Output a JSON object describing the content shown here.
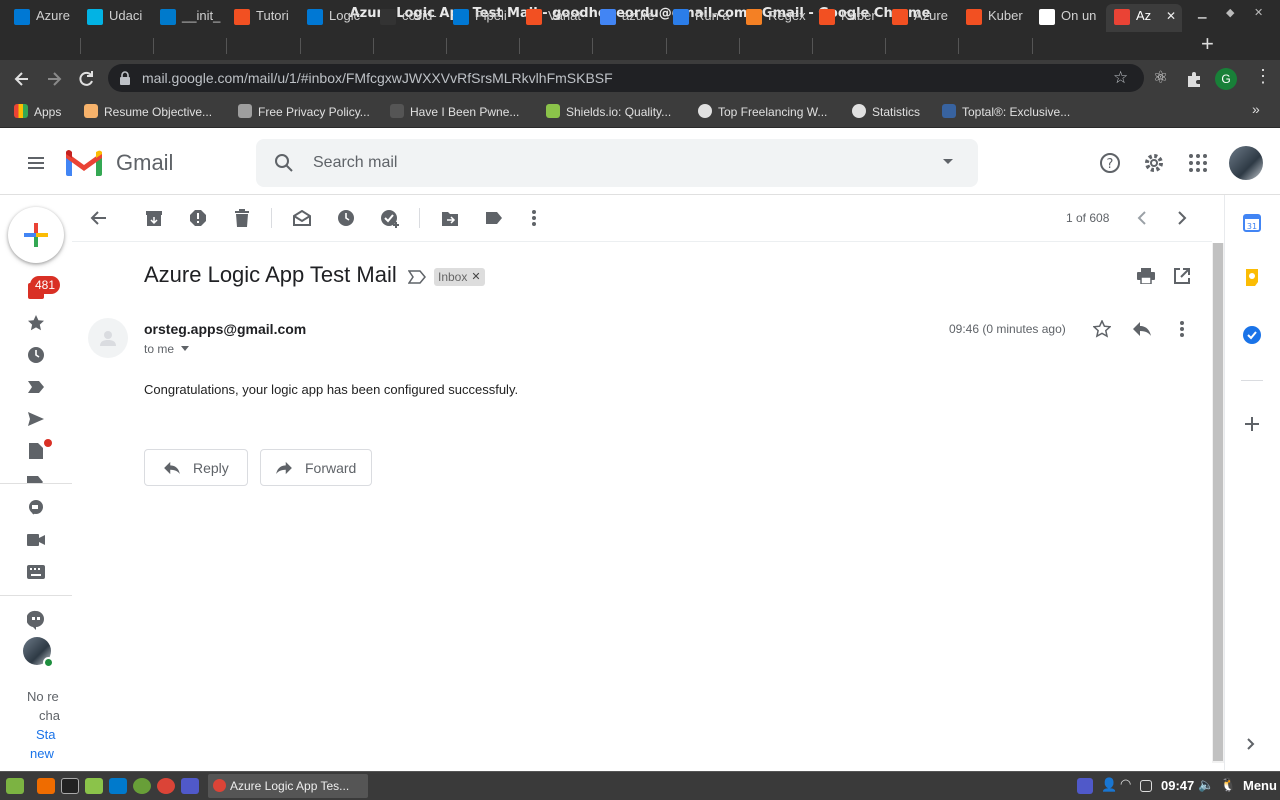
{
  "window": {
    "title": "Azure Logic App Test Mail - goodhopeordu@gmail.com - Gmail - Google Chrome"
  },
  "tabs": [
    {
      "label": "Azure",
      "color": "#0078d4"
    },
    {
      "label": "Udaci",
      "color": "#02b3e4"
    },
    {
      "label": "__init_",
      "color": "#007acc"
    },
    {
      "label": "Tutori",
      "color": "#f25022"
    },
    {
      "label": "Logic",
      "color": "#0078d4"
    },
    {
      "label": "covid-",
      "color": "#333333"
    },
    {
      "label": "Pipeli",
      "color": "#0078d4"
    },
    {
      "label": "Variat",
      "color": "#f25022"
    },
    {
      "label": "azure",
      "color": "#4285f4"
    },
    {
      "label": "Run a",
      "color": "#2b7de9"
    },
    {
      "label": "Regex",
      "color": "#f48024"
    },
    {
      "label": "Kuber",
      "color": "#f25022"
    },
    {
      "label": "Azure",
      "color": "#f25022"
    },
    {
      "label": "Kuber",
      "color": "#f25022"
    },
    {
      "label": "On un",
      "color": "#ffffff"
    },
    {
      "label": "Az",
      "color": "#ea4335"
    }
  ],
  "browser": {
    "url": "mail.google.com/mail/u/1/#inbox/FMfcgxwJWXXVvRfSrsMLRkvlhFmSKBSF",
    "profile_initial": "G"
  },
  "bookmarks": [
    {
      "label": "Apps",
      "color": "#4285f4"
    },
    {
      "label": "Resume Objective...",
      "color": "#f6b26b"
    },
    {
      "label": "Free Privacy Policy...",
      "color": "#9e9e9e"
    },
    {
      "label": "Have I Been Pwne...",
      "color": "#555555"
    },
    {
      "label": "Shields.io: Quality...",
      "color": "#8bc34a"
    },
    {
      "label": "Top Freelancing W...",
      "color": "#e0e0e0"
    },
    {
      "label": "Statistics",
      "color": "#e0e0e0"
    },
    {
      "label": "Toptal®: Exclusive...",
      "color": "#3863a0"
    }
  ],
  "gmail": {
    "logo_text": "Gmail",
    "search_placeholder": "Search mail",
    "inbox_badge": "481",
    "pagination": "1 of 608",
    "chat_text_1": "No re",
    "chat_text_2": "cha",
    "chat_link_1": "Sta",
    "chat_link_2": "new"
  },
  "email": {
    "subject": "Azure Logic App Test Mail",
    "label": "Inbox",
    "sender": "orsteg.apps@gmail.com",
    "recipient": "to me",
    "time": "09:46 (0 minutes ago)",
    "body": "Congratulations, your logic app has been configured successfuly.",
    "reply_label": "Reply",
    "forward_label": "Forward"
  },
  "taskbar": {
    "window_label": "Azure Logic App Tes...",
    "clock": "09:47",
    "menu_label": "Menu"
  },
  "colors": {
    "gmail_red": "#ea4335",
    "accent_blue": "#1a73e8",
    "badge_red": "#d93025"
  }
}
